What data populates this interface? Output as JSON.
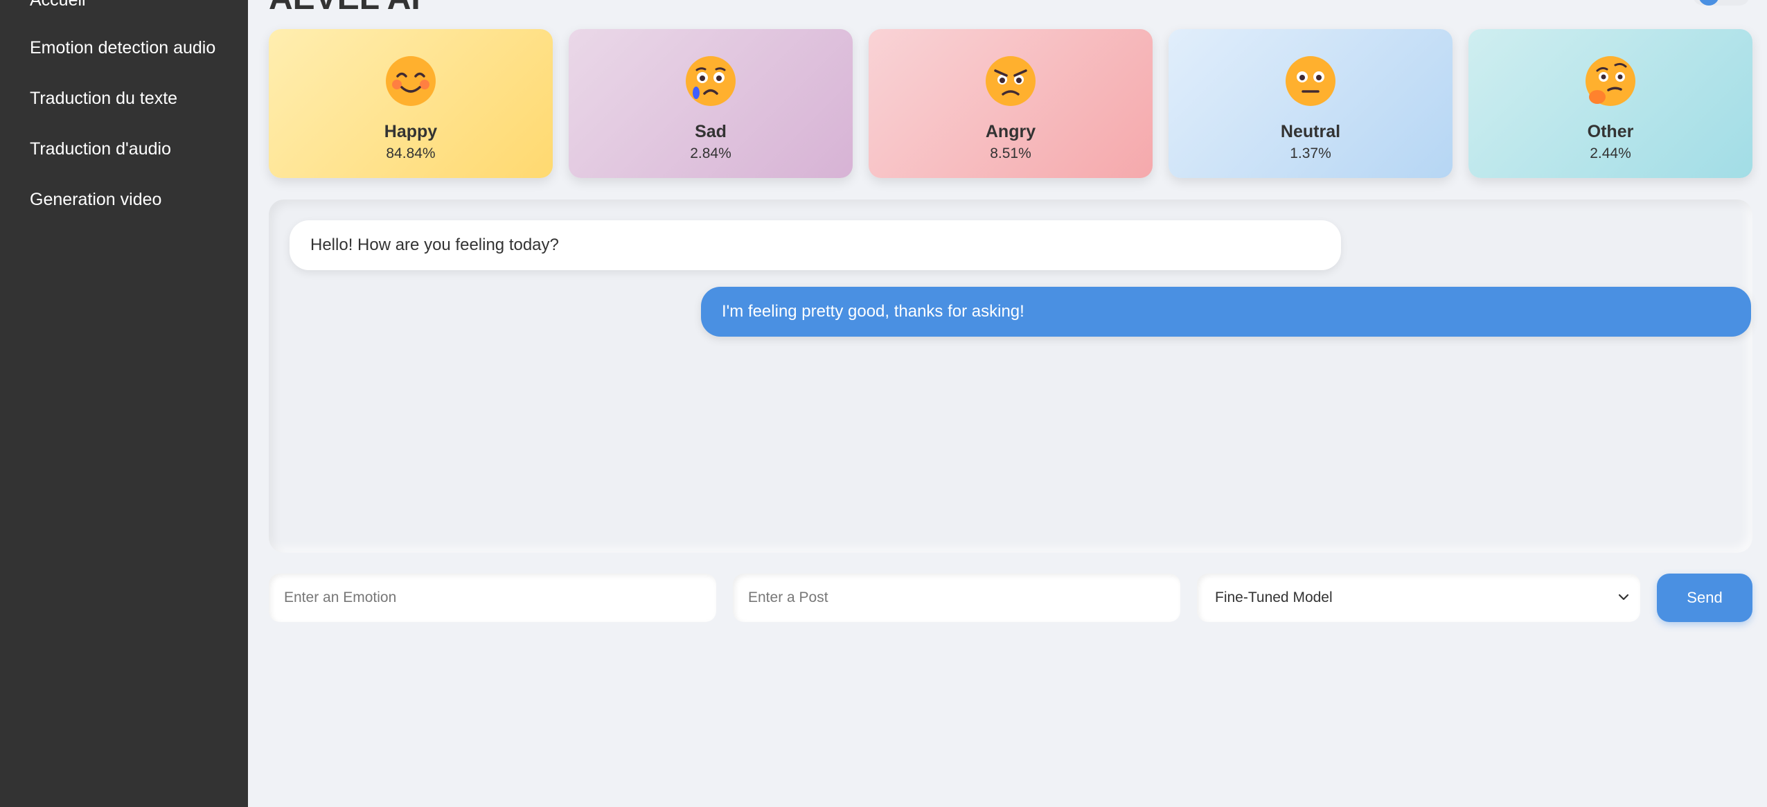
{
  "app": {
    "title": "AEVEL AI"
  },
  "sidebar": {
    "items": [
      {
        "label": "Accueil"
      },
      {
        "label": "Emotion detection audio"
      },
      {
        "label": "Traduction du texte"
      },
      {
        "label": "Traduction d'audio"
      },
      {
        "label": "Generation video"
      }
    ]
  },
  "emotions": [
    {
      "label": "Happy",
      "value": "84.84%",
      "icon": "smiling-face-icon",
      "colors": [
        "#ffeeb0",
        "#ffd970"
      ]
    },
    {
      "label": "Sad",
      "value": "2.84%",
      "icon": "crying-face-icon",
      "colors": [
        "#ead8e8",
        "#d7b3d5"
      ]
    },
    {
      "label": "Angry",
      "value": "8.51%",
      "icon": "angry-face-icon",
      "colors": [
        "#f9d3d6",
        "#f5a9ac"
      ]
    },
    {
      "label": "Neutral",
      "value": "1.37%",
      "icon": "neutral-face-icon",
      "colors": [
        "#e1eefb",
        "#b6d6f4"
      ]
    },
    {
      "label": "Other",
      "value": "2.44%",
      "icon": "thinking-face-icon",
      "colors": [
        "#cfeef0",
        "#a2dde6"
      ]
    }
  ],
  "chat": {
    "messages": [
      {
        "from": "bot",
        "text": "Hello! How are you feeling today?"
      },
      {
        "from": "user",
        "text": "I'm feeling pretty good, thanks for asking!"
      }
    ]
  },
  "form": {
    "emotion_placeholder": "Enter an Emotion",
    "post_placeholder": "Enter a Post",
    "model_selected": "Fine-Tuned Model",
    "send_label": "Send"
  },
  "colors": {
    "accent": "#4a90e2",
    "sidebar_bg": "#333333",
    "page_bg": "#f0f2f6"
  }
}
